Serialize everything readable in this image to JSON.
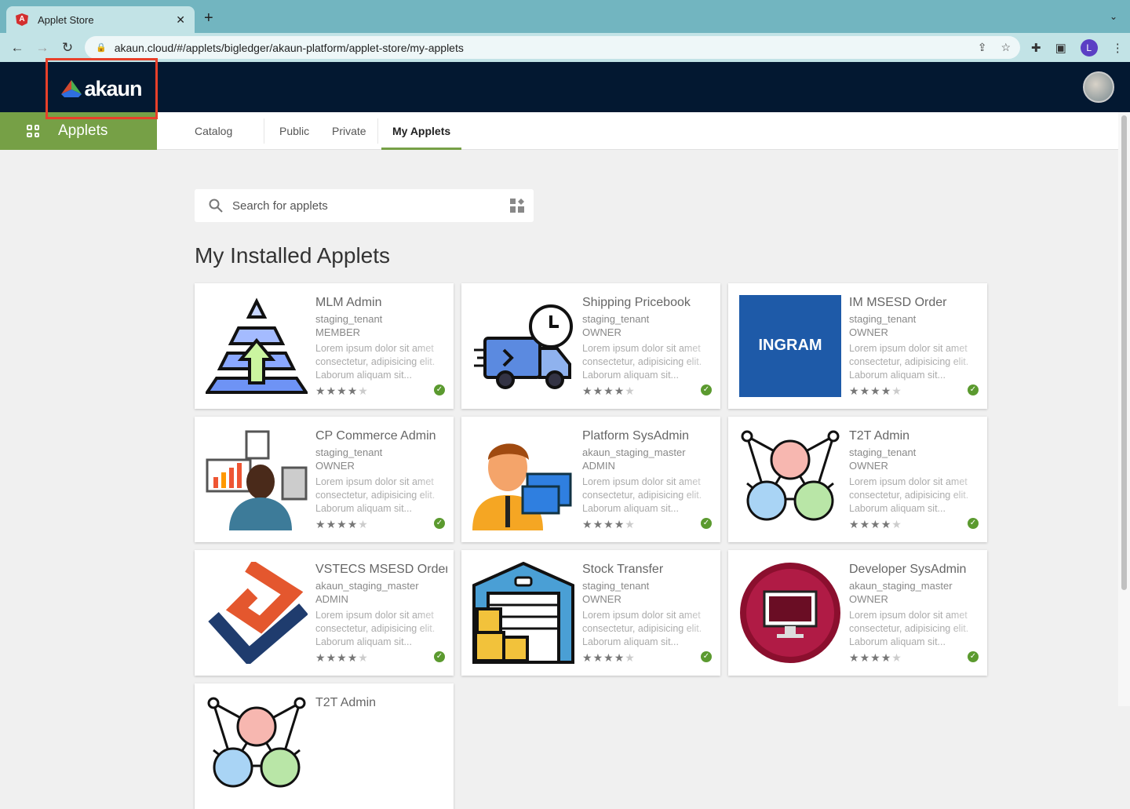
{
  "browser": {
    "tab_title": "Applet Store",
    "url": "akaun.cloud/#/applets/bigledger/akaun-platform/applet-store/my-applets",
    "profile_initial": "L"
  },
  "header": {
    "logo_text": "akaun"
  },
  "subnav": {
    "section": "Applets",
    "tabs": [
      "Catalog",
      "Public",
      "Private",
      "My Applets"
    ],
    "active": "My Applets"
  },
  "search": {
    "placeholder": "Search for applets"
  },
  "page_title": "My Installed Applets",
  "colors": {
    "accent": "#76a046",
    "header": "#031831",
    "highlight": "#e8402a"
  },
  "applets": [
    {
      "name": "MLM Admin",
      "tenant": "staging_tenant",
      "role": "MEMBER",
      "desc": "Lorem ipsum dolor sit amet consectetur, adipisicing elit. Laborum aliquam sit...",
      "rating": 4,
      "installed": true,
      "icon": "pyramid-arrow-icon"
    },
    {
      "name": "Shipping Pricebook",
      "tenant": "staging_tenant",
      "role": "OWNER",
      "desc": "Lorem ipsum dolor sit amet consectetur, adipisicing elit. Laborum aliquam sit...",
      "rating": 4,
      "installed": true,
      "icon": "delivery-truck-icon"
    },
    {
      "name": "IM MSESD Order",
      "tenant": "staging_tenant",
      "role": "OWNER",
      "desc": "Lorem ipsum dolor sit amet consectetur, adipisicing elit. Laborum aliquam sit...",
      "rating": 4,
      "installed": true,
      "icon": "ingram-logo",
      "logo_text": "INGRAM"
    },
    {
      "name": "CP Commerce Admin",
      "tenant": "staging_tenant",
      "role": "OWNER",
      "desc": "Lorem ipsum dolor sit amet consectetur, adipisicing elit. Laborum aliquam sit...",
      "rating": 4,
      "installed": true,
      "icon": "analyst-icon"
    },
    {
      "name": "Platform SysAdmin",
      "tenant": "akaun_staging_master",
      "role": "ADMIN",
      "desc": "Lorem ipsum dolor sit amet consectetur, adipisicing elit. Laborum aliquam sit...",
      "rating": 4,
      "installed": true,
      "icon": "admin-person-icon"
    },
    {
      "name": "T2T Admin",
      "tenant": "staging_tenant",
      "role": "OWNER",
      "desc": "Lorem ipsum dolor sit amet consectetur, adipisicing elit. Laborum aliquam sit...",
      "rating": 4,
      "installed": true,
      "icon": "network-people-icon"
    },
    {
      "name": "VSTECS MSESD Order",
      "tenant": "akaun_staging_master",
      "role": "ADMIN",
      "desc": "Lorem ipsum dolor sit amet consectetur, adipisicing elit. Laborum aliquam sit...",
      "rating": 4,
      "installed": true,
      "icon": "vstecs-logo"
    },
    {
      "name": "Stock Transfer",
      "tenant": "staging_tenant",
      "role": "OWNER",
      "desc": "Lorem ipsum dolor sit amet consectetur, adipisicing elit. Laborum aliquam sit...",
      "rating": 4,
      "installed": true,
      "icon": "warehouse-icon"
    },
    {
      "name": "Developer SysAdmin",
      "tenant": "akaun_staging_master",
      "role": "OWNER",
      "desc": "Lorem ipsum dolor sit amet consectetur, adipisicing elit. Laborum aliquam sit...",
      "rating": 4,
      "installed": true,
      "icon": "monitor-icon"
    },
    {
      "name": "T2T Admin",
      "tenant": "",
      "role": "",
      "desc": "",
      "rating": 0,
      "installed": false,
      "icon": "network-people-icon"
    }
  ]
}
